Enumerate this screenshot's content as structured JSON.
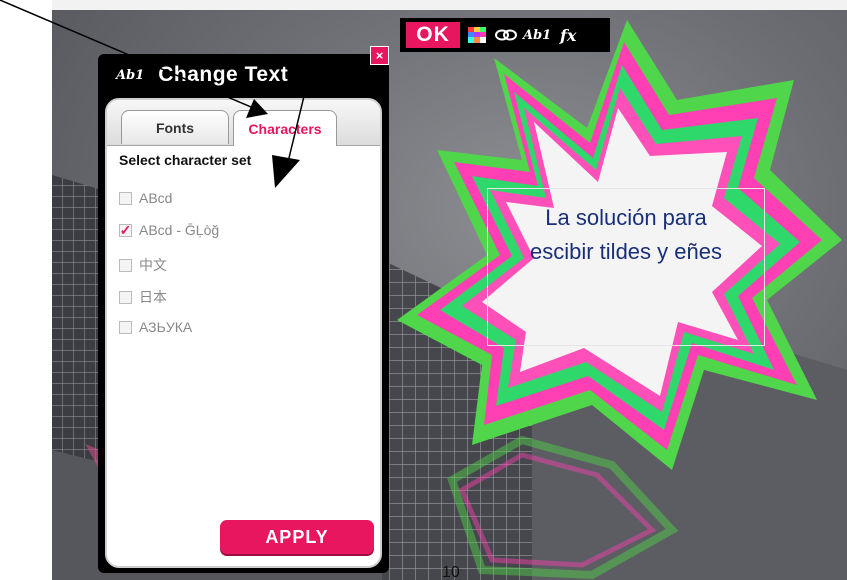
{
  "toolbar": {
    "ok_label": "OK",
    "icons": [
      "color-grid-icon",
      "link-icon",
      "text-style-icon",
      "effects-icon"
    ],
    "ab_label": "Ab1",
    "fx_label": "fx"
  },
  "panel": {
    "title": "Change Text",
    "header_icon_label": "Ab1",
    "close_label": "×",
    "tabs": [
      {
        "label": "Fonts",
        "active": false
      },
      {
        "label": "Characters",
        "active": true
      }
    ],
    "section_title": "Select character set",
    "options": [
      {
        "label": "ABcd",
        "checked": false
      },
      {
        "label": "ABcd - ḠḶòğ",
        "checked": true
      },
      {
        "label": "中文",
        "checked": false
      },
      {
        "label": "日本",
        "checked": false
      },
      {
        "label": "АЗЬУКА",
        "checked": false
      }
    ],
    "apply_label": "APPLY"
  },
  "canvas": {
    "text_line_1": "La solución para",
    "text_line_2": "escibir tildes y eñes",
    "stray_text": "10"
  },
  "colors": {
    "accent": "#e8155f",
    "star_green": "#4fd64a",
    "star_pink": "#ff3fb3",
    "text_blue": "#1a2f7a"
  }
}
